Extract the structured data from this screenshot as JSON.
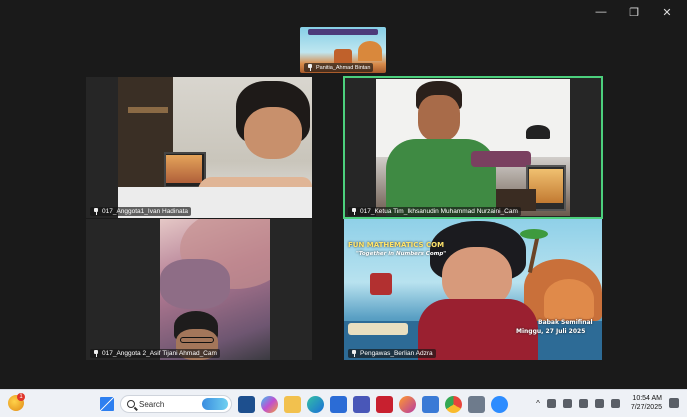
{
  "window": {
    "controls": [
      "—",
      "❐",
      "✕"
    ]
  },
  "participants": {
    "self_view": {
      "name": "Panitia_Ahmad Bintan"
    },
    "tile1": {
      "name": "017_Anggota1_Ivan Hadinata"
    },
    "tile2": {
      "name": "017_Ketua Tim_Ikhsanudin Muhammad Nurzaini_Cam"
    },
    "tile3": {
      "name": "017_Anggota 2_Asif Tijani Ahmad_Cam"
    },
    "tile4": {
      "name": "Pengawas_Berlian Adzra",
      "poster": {
        "title": "FUN MATHEMATICS COM",
        "subtitle": "\"Together in Numbers Comp\"",
        "stage": "Babak Semifinal",
        "date": "Minggu, 27 Juli 2025"
      }
    }
  },
  "taskbar": {
    "notification_count": "1",
    "search_placeholder": "Search",
    "apps": [
      "windows-start",
      "widgets",
      "copilot",
      "file-explorer",
      "edge",
      "store",
      "teams",
      "mcafee",
      "firefox",
      "photos",
      "chrome",
      "capture",
      "zoom"
    ],
    "time": "10:54 AM",
    "date": "7/27/2025"
  }
}
